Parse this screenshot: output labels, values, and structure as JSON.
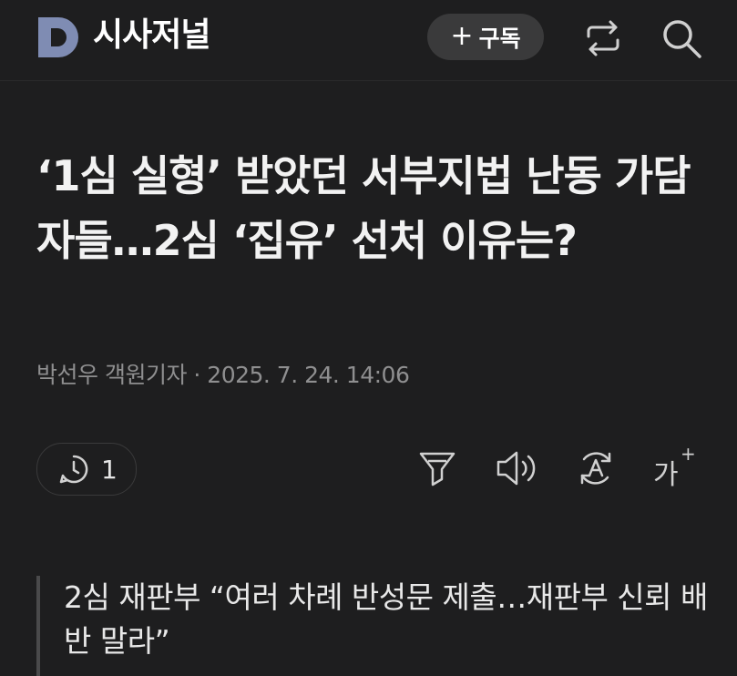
{
  "header": {
    "logo_icon": "d-logo-icon",
    "outlet_name": "시사저널",
    "subscribe_label": "구독",
    "subscribe_plus": "+",
    "share_icon": "share-icon",
    "search_icon": "search-icon"
  },
  "article": {
    "headline": "‘1심 실형’ 받았던 서부지법 난동 가담자들…2심 ‘집유’ 선처 이유는?",
    "byline": "박선우 객원기자 · 2025. 7. 24. 14:06",
    "comment_count": "1",
    "subheading": "2심 재판부 “여러 차례 반성문 제출…재판부 신뢰 배반 말라”"
  },
  "toolbar": {
    "font_size_label": "가",
    "font_size_plus": "+",
    "icons": [
      "summary-funnel-icon",
      "speaker-icon",
      "translate-icon",
      "font-size-icon"
    ]
  },
  "colors": {
    "background": "#1e1e1f",
    "logo": "#7f8cb3",
    "pill": "#3a3a3b",
    "muted_text": "#8f8f90"
  }
}
